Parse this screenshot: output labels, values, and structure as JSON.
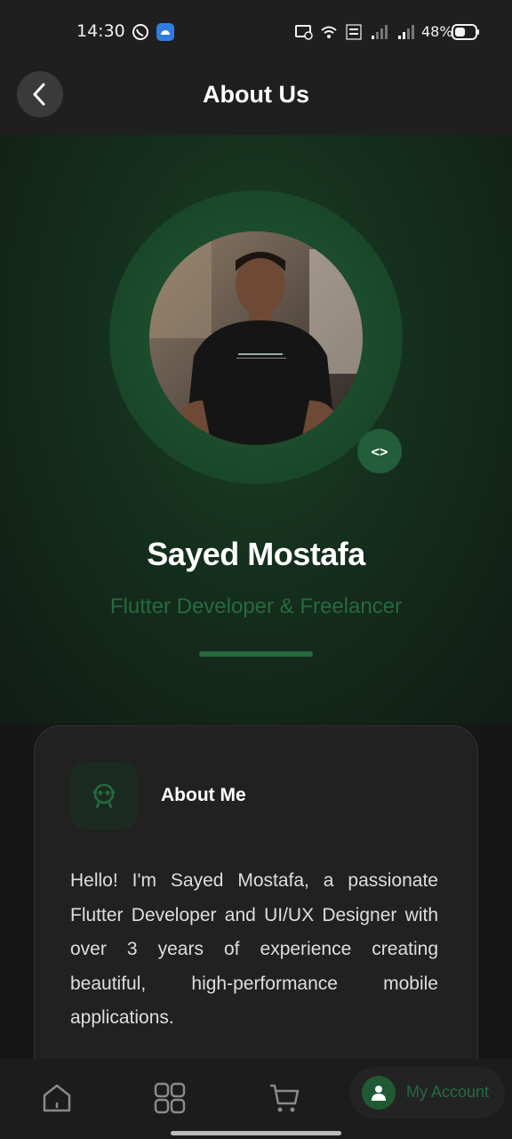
{
  "status_bar": {
    "time": "14:30",
    "battery": "48%",
    "icons": [
      "whatsapp-icon",
      "android-icon",
      "cast-icon",
      "wifi-icon",
      "volte-icon",
      "signal-icon",
      "signal-icon",
      "battery-icon"
    ]
  },
  "app_bar": {
    "title": "About Us",
    "back_icon": "chevron-left-icon"
  },
  "profile": {
    "name": "Sayed Mostafa",
    "role": "Flutter Developer & Freelancer",
    "badge_icon": "code-icon",
    "badge_text": "<>"
  },
  "about_card": {
    "title": "About Me",
    "icon": "mascot-icon",
    "text": "Hello! I'm Sayed Mostafa, a passionate Flutter Developer and UI/UX Designer with over 3 years of experience creating beautiful, high-performance mobile applications."
  },
  "bottom_nav": {
    "items": [
      {
        "icon": "home-icon"
      },
      {
        "icon": "grid-icon"
      },
      {
        "icon": "cart-icon"
      },
      {
        "icon": "person-icon",
        "label": "My Account",
        "active": true
      }
    ]
  },
  "colors": {
    "accent": "#256b3e",
    "background": "#161616",
    "card": "#212121"
  }
}
